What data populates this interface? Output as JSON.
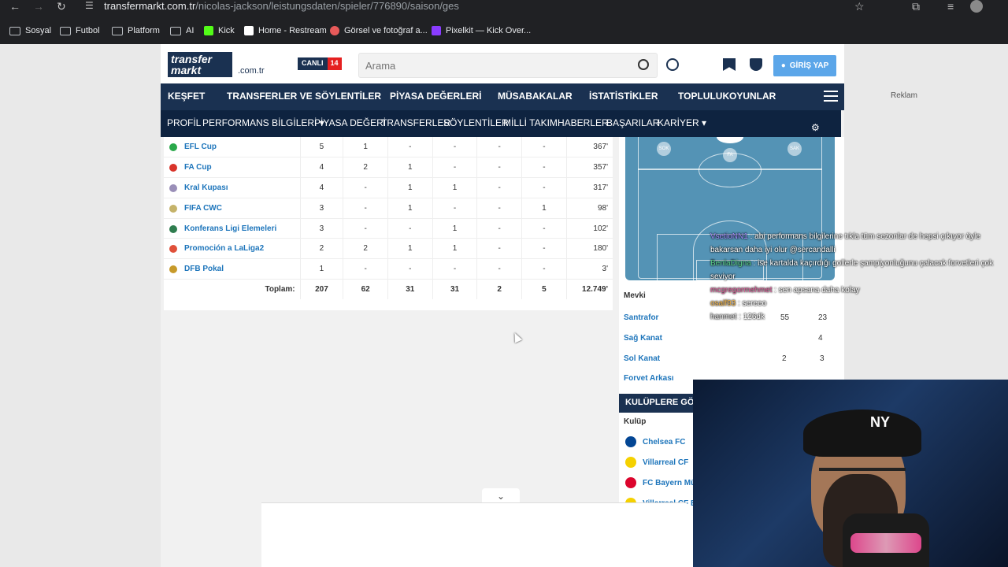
{
  "browser": {
    "url_host": "transfermarkt.com.tr",
    "url_path": "/nicolas-jackson/leistungsdaten/spieler/776890/saison/ges",
    "bookmarks": [
      "Sosyal",
      "Futbol",
      "Platform",
      "AI",
      "Kick",
      "Home - Restream",
      "Görsel ve fotoğraf a...",
      "Pixelkit — Kick Over..."
    ]
  },
  "header": {
    "logo_line1": "transfer",
    "logo_line2": "markt",
    "domain": ".com.tr",
    "live_label": "CANLI",
    "live_count": "14",
    "search_placeholder": "Arama",
    "login_label": "GİRİŞ YAP"
  },
  "main_nav": [
    "KEŞFET",
    "TRANSFERLER VE SÖYLENTİLER",
    "PİYASA DEĞERLERİ",
    "MÜSABAKALAR",
    "İSTATİSTİKLER",
    "TOPLULUK",
    "OYUNLAR"
  ],
  "sub_nav": [
    "PROFİL",
    "PERFORMANS BİLGİLERİ ▾",
    "PİYASA DEĞERİ",
    "TRANSFERLER",
    "SÖYLENTİLER",
    "MİLLİ TAKIM",
    "HABERLER",
    "BAŞARILAR",
    "KARİYER ▾"
  ],
  "stats": {
    "rows": [
      {
        "comp": "EFL Cup",
        "color": "#2aa84a",
        "c": [
          "5",
          "1",
          "-",
          "-",
          "-",
          "-",
          "367'"
        ]
      },
      {
        "comp": "FA Cup",
        "color": "#d9342b",
        "c": [
          "4",
          "2",
          "1",
          "-",
          "-",
          "-",
          "357'"
        ]
      },
      {
        "comp": "Kral Kupası",
        "color": "#9a8fb8",
        "c": [
          "4",
          "-",
          "1",
          "1",
          "-",
          "-",
          "317'"
        ]
      },
      {
        "comp": "FIFA CWC",
        "color": "#c5b36a",
        "c": [
          "3",
          "-",
          "1",
          "-",
          "-",
          "1",
          "98'"
        ]
      },
      {
        "comp": "Konferans Ligi Elemeleri",
        "color": "#2f7d4f",
        "c": [
          "3",
          "-",
          "-",
          "1",
          "-",
          "-",
          "102'"
        ]
      },
      {
        "comp": "Promoción a LaLiga2",
        "color": "#e0503a",
        "c": [
          "2",
          "2",
          "1",
          "1",
          "-",
          "-",
          "180'"
        ]
      },
      {
        "comp": "DFB Pokal",
        "color": "#c79a2a",
        "c": [
          "1",
          "-",
          "-",
          "-",
          "-",
          "-",
          "3'"
        ]
      }
    ],
    "total_label": "Toplam:",
    "totals": [
      "207",
      "62",
      "31",
      "31",
      "2",
      "5",
      "12.749'"
    ]
  },
  "positions": {
    "header": "Mevki",
    "pitch_labels": [
      "SOK",
      "FA",
      "SAK"
    ],
    "rows": [
      {
        "name": "Santrafor",
        "a": "55",
        "b": "23"
      },
      {
        "name": "Sağ Kanat",
        "a": "",
        "b": "4"
      },
      {
        "name": "Sol Kanat",
        "a": "2",
        "b": "3"
      },
      {
        "name": "Forvet Arkası",
        "a": "",
        "b": ""
      }
    ]
  },
  "clubs": {
    "header": "KULÜPLERE GÖRE",
    "col_label": "Kulüp",
    "rows": [
      {
        "name": "Chelsea FC",
        "color": "#034694"
      },
      {
        "name": "Villarreal CF",
        "color": "#f5d100"
      },
      {
        "name": "FC Bayern Mün",
        "color": "#dc052d"
      },
      {
        "name": "Villarreal CF B",
        "color": "#f5d100"
      }
    ]
  },
  "ad_label": "Reklam",
  "chat": [
    {
      "user": "VsetioNN1",
      "cls": "u1",
      "msg": "abi performans bilgilerine tıkla tüm sezonlar de hepsi çıkıyor öyle bakarsan daha iyi olur @sercandalli"
    },
    {
      "user": "BenlaDigna",
      "cls": "u2",
      "msg": "ise kartalda kaçırdığı gollerle şampiyonluğunu çalacak forvetleri çok seviyor"
    },
    {
      "user": "mcgregormehmet",
      "cls": "u3",
      "msg": "sen apsana daha kolay"
    },
    {
      "user": "osalf93",
      "cls": "u4",
      "msg": "sereeo"
    },
    {
      "user": "hanmet",
      "cls": "u5",
      "msg": "126dk"
    }
  ]
}
